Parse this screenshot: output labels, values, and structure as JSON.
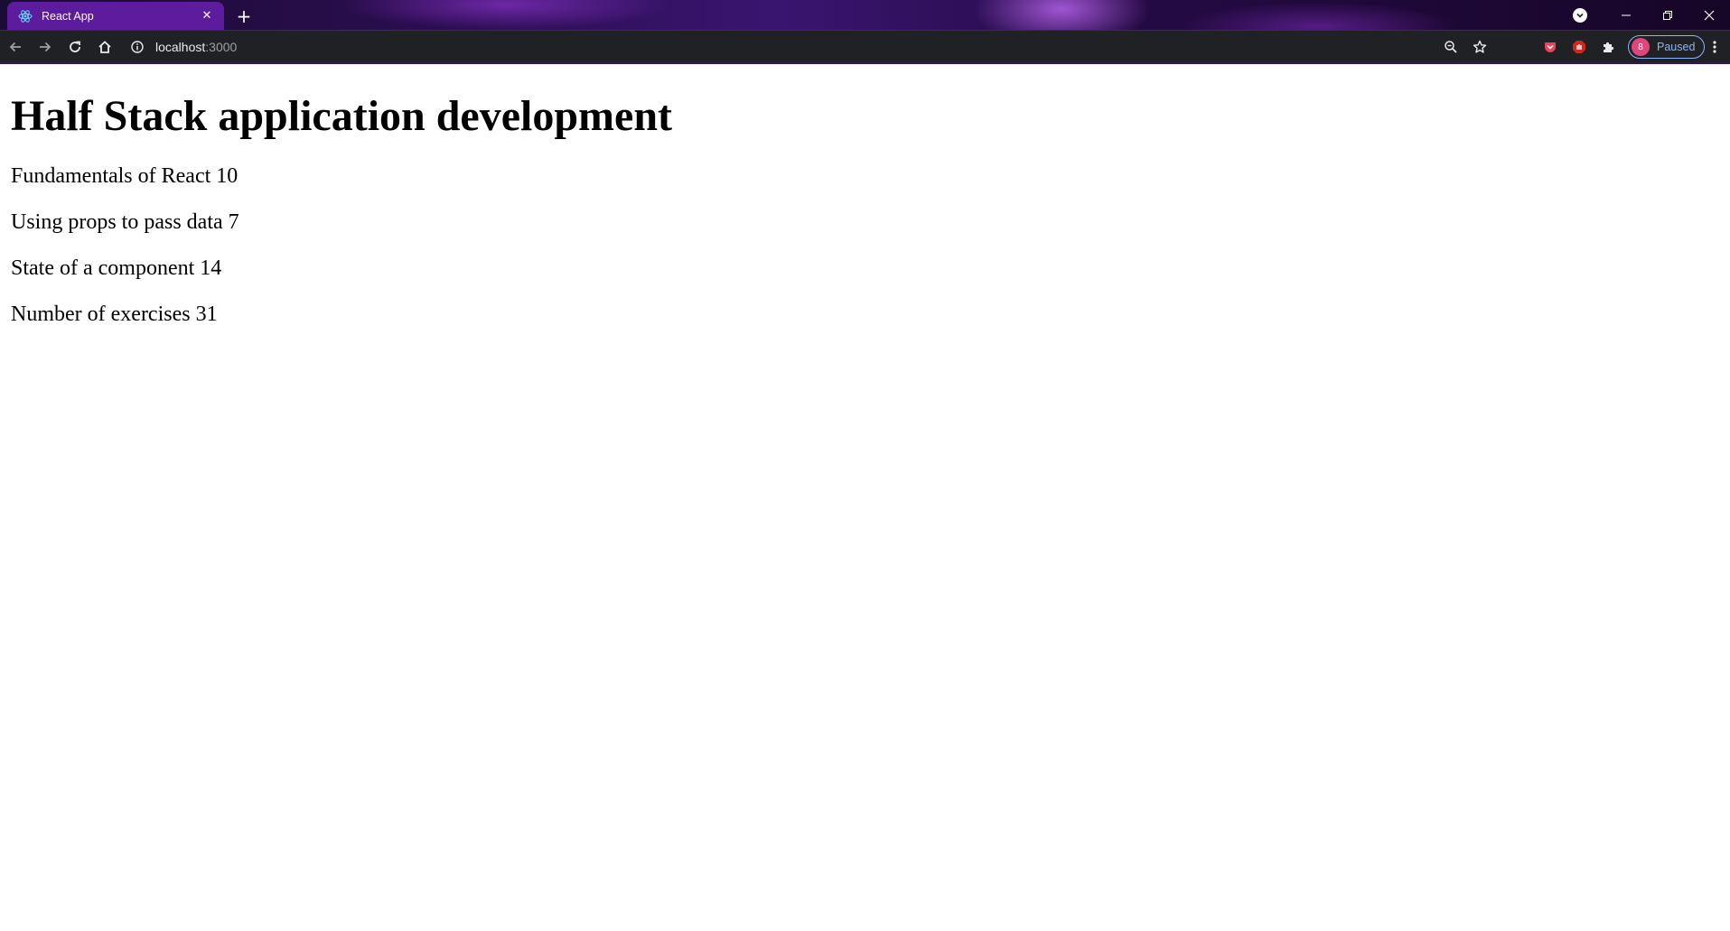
{
  "browser": {
    "tab": {
      "title": "React App",
      "favicon": "react-logo-icon"
    },
    "address_bar": {
      "host": "localhost",
      "port": ":3000"
    },
    "profile": {
      "avatar_letter": "8",
      "status": "Paused"
    },
    "icons": {
      "back": "arrow-left-icon",
      "forward": "arrow-right-icon",
      "reload": "reload-icon",
      "home": "home-icon",
      "site_info": "info-icon",
      "zoom": "zoom-icon",
      "bookmark": "star-icon",
      "extensions": [
        "pocket-icon",
        "adblock-icon",
        "puzzle-icon"
      ],
      "menu": "kebab-menu-icon"
    },
    "colors": {
      "tab_active": "#5d1c9e",
      "toolbar": "#202124",
      "accent": "#8ab4f8",
      "avatar": "#e0457b"
    }
  },
  "page": {
    "heading": "Half Stack application development",
    "parts": [
      "Fundamentals of React 10",
      "Using props to pass data 7",
      "State of a component 14"
    ],
    "total": "Number of exercises 31"
  }
}
